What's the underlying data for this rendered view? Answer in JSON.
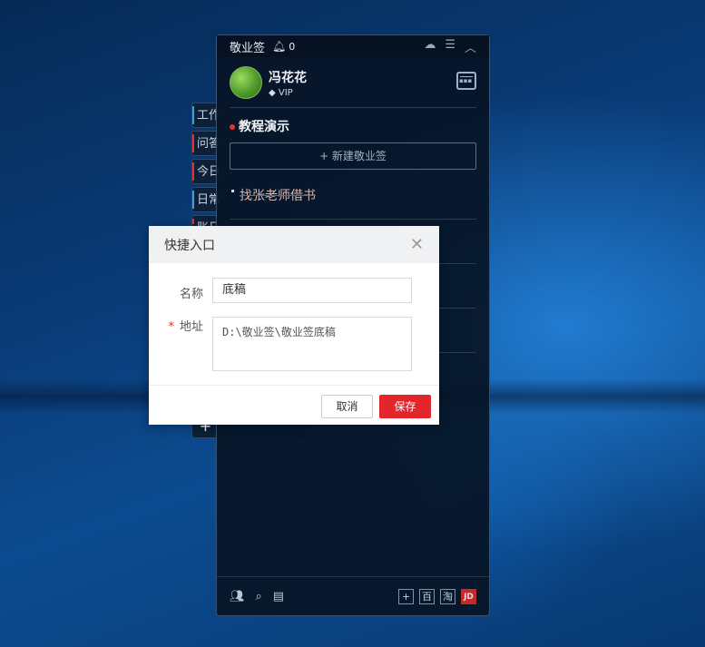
{
  "side_tabs": [
    {
      "label": "工作",
      "accent": "#3aa0e0"
    },
    {
      "label": "问答",
      "accent": "#e5332b"
    },
    {
      "label": "今日",
      "accent": "#e5332b"
    },
    {
      "label": "日常",
      "accent": "#3aa0e0"
    },
    {
      "label": "账日",
      "accent": "#e5332b"
    }
  ],
  "widget": {
    "title": "敬业签",
    "notification_count": "0",
    "user": {
      "name": "冯花花",
      "badge": "VIP"
    },
    "category": "教程演示",
    "new_note_label": "+ 新建敬业签",
    "notes": [
      {
        "text": "找张老师借书",
        "completed": true
      }
    ]
  },
  "dialog": {
    "title": "快捷入口",
    "name_label": "名称",
    "name_value": "底稿",
    "address_required_mark": "*",
    "address_label": "地址",
    "address_value": "D:\\敬业签\\敬业签底稿",
    "cancel_label": "取消",
    "save_label": "保存"
  },
  "bottom_icons": {
    "add": "+",
    "baidu": "百",
    "taobao": "淘",
    "jd": "JD"
  },
  "colors": {
    "accent_red": "#e2262b",
    "panel": "#08142a"
  }
}
